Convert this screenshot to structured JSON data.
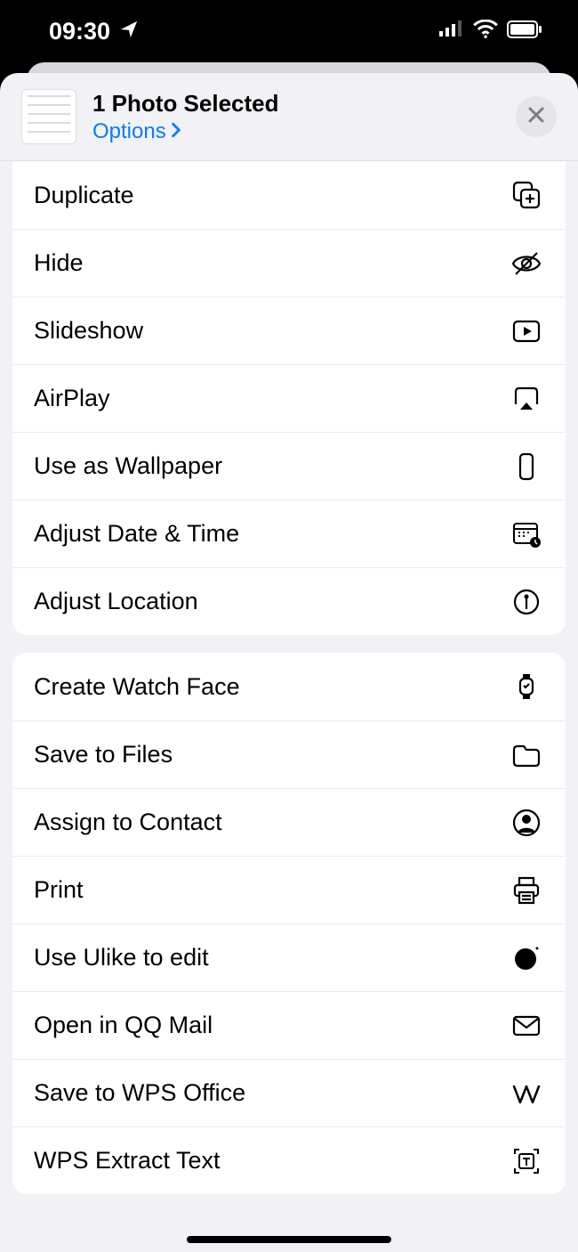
{
  "statusbar": {
    "time": "09:30"
  },
  "header": {
    "title": "1 Photo Selected",
    "options": "Options"
  },
  "groups": [
    {
      "items": [
        {
          "label": "Duplicate",
          "icon": "duplicate-icon"
        },
        {
          "label": "Hide",
          "icon": "hide-icon"
        },
        {
          "label": "Slideshow",
          "icon": "slideshow-icon"
        },
        {
          "label": "AirPlay",
          "icon": "airplay-icon"
        },
        {
          "label": "Use as Wallpaper",
          "icon": "wallpaper-icon"
        },
        {
          "label": "Adjust Date & Time",
          "icon": "calendar-clock-icon"
        },
        {
          "label": "Adjust Location",
          "icon": "location-pin-icon"
        }
      ]
    },
    {
      "items": [
        {
          "label": "Create Watch Face",
          "icon": "watch-icon"
        },
        {
          "label": "Save to Files",
          "icon": "folder-icon"
        },
        {
          "label": "Assign to Contact",
          "icon": "contact-icon"
        },
        {
          "label": "Print",
          "icon": "print-icon"
        },
        {
          "label": "Use Ulike to edit",
          "icon": "ulike-icon"
        },
        {
          "label": "Open in QQ Mail",
          "icon": "mail-icon"
        },
        {
          "label": "Save to WPS Office",
          "icon": "wps-icon"
        },
        {
          "label": "WPS Extract Text",
          "icon": "extract-text-icon"
        }
      ]
    }
  ]
}
